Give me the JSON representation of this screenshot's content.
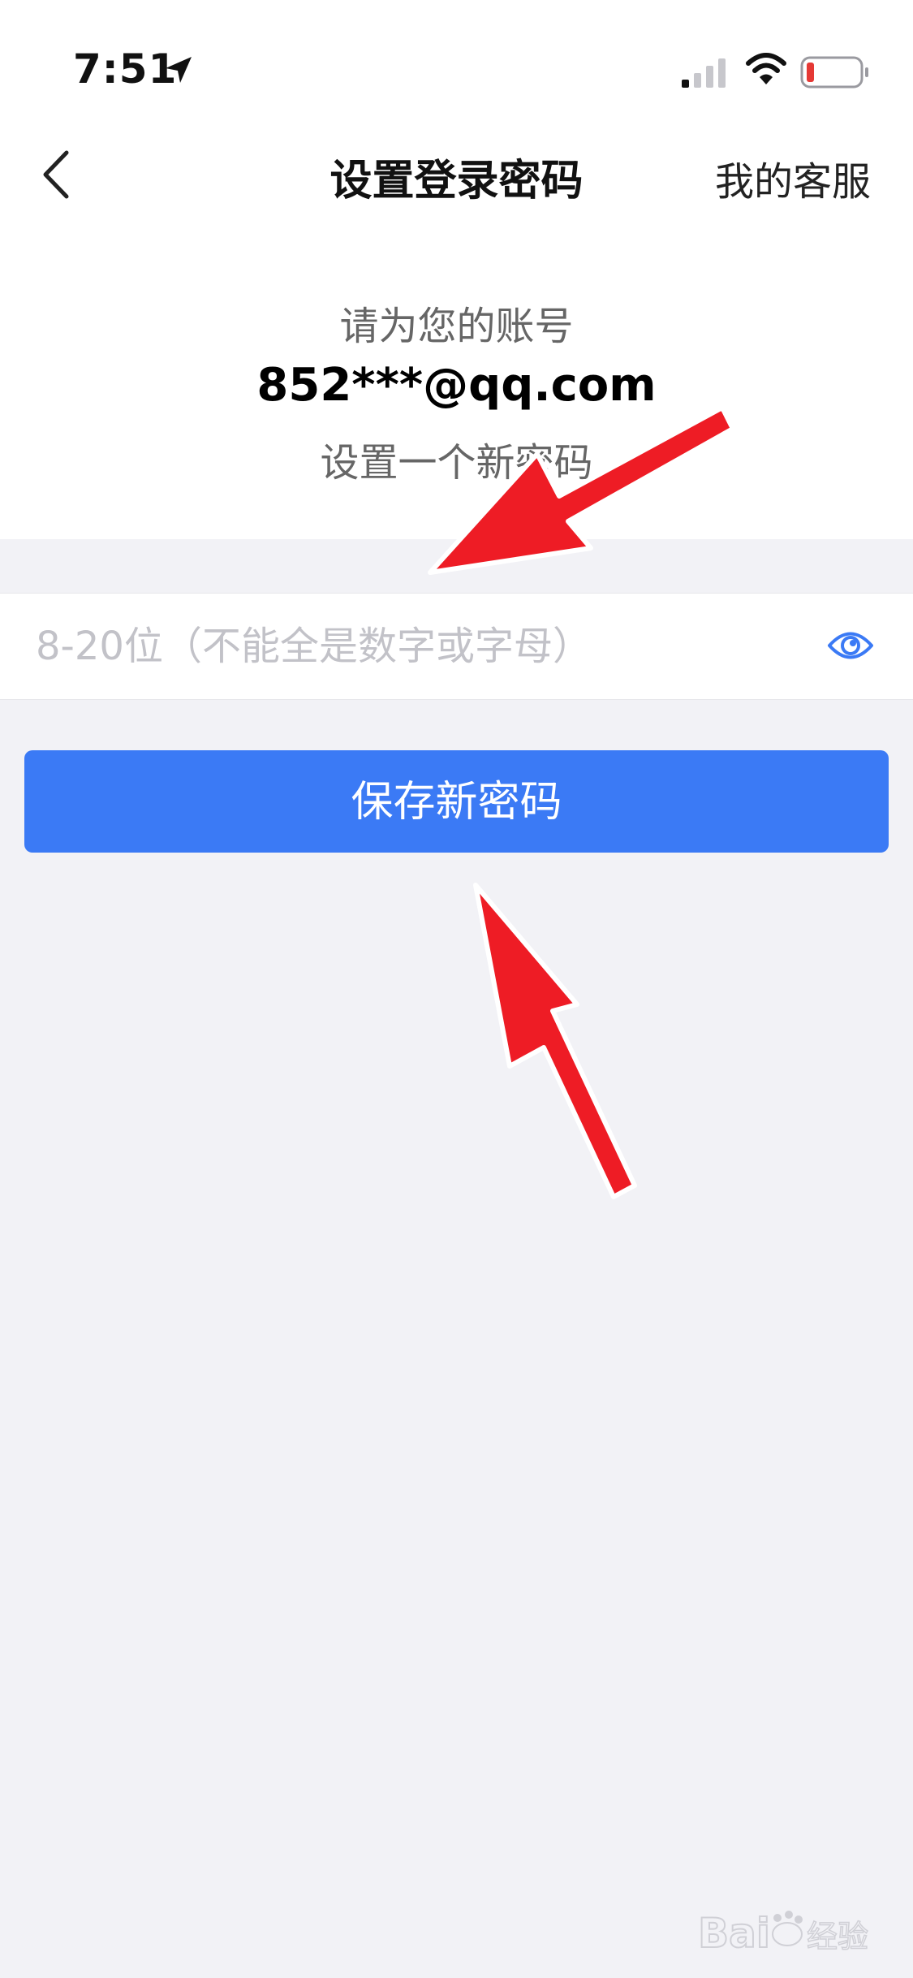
{
  "status_bar": {
    "time": "7:51"
  },
  "nav": {
    "title": "设置登录密码",
    "right_action": "我的客服"
  },
  "prompt": {
    "line1": "请为您的账号",
    "account": "852***@qq.com",
    "line3": "设置一个新密码"
  },
  "password": {
    "value": "",
    "placeholder": "8-20位（不能全是数字或字母）"
  },
  "save_button": {
    "label": "保存新密码"
  },
  "colors": {
    "accent": "#3b7af5",
    "annotation_arrow": "#ee1c25",
    "page_bg": "#f2f2f6"
  },
  "icons": [
    "location-arrow-icon",
    "signal-icon",
    "wifi-icon",
    "battery-low-icon",
    "back-chevron-icon",
    "eye-icon"
  ],
  "watermark": {
    "text": "Baidu经验"
  }
}
